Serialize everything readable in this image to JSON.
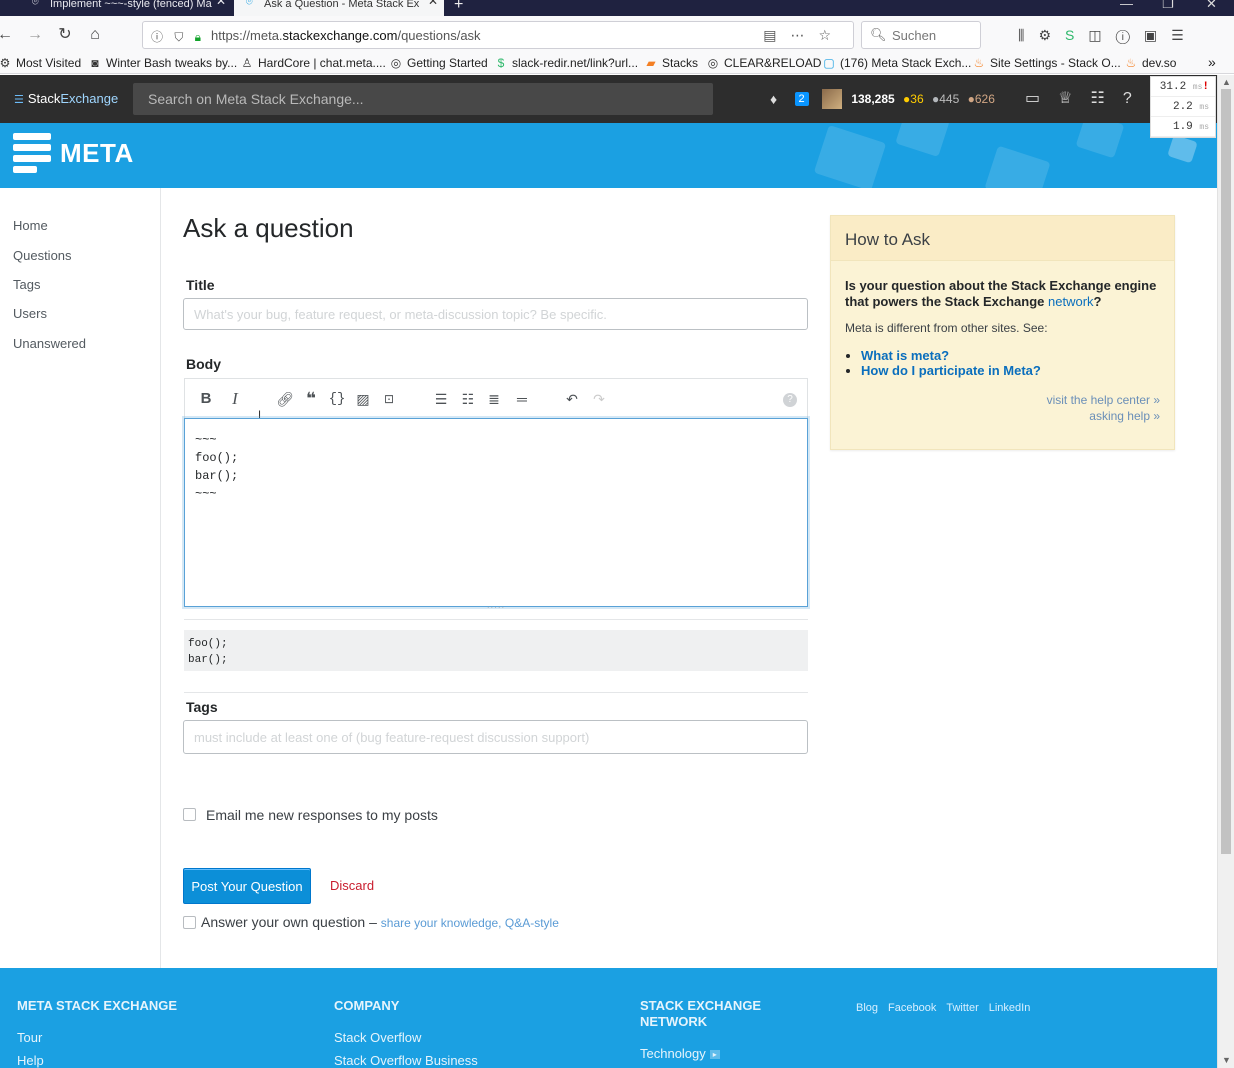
{
  "browser": {
    "tabs": [
      {
        "label": "Implement ~~~-style (fenced) Ma"
      },
      {
        "label": "Ask a Question - Meta Stack Ex"
      }
    ],
    "url_prefix": "https://meta.",
    "url_domain": "stackexchange.com",
    "url_path": "/questions/ask",
    "search_placeholder": "Suchen",
    "bookmarks": [
      "Most Visited",
      "Winter Bash tweaks by...",
      "HardCore | chat.meta....",
      "Getting Started",
      "slack-redir.net/link?url...",
      "Stacks",
      "CLEAR&RELOAD",
      "(176) Meta Stack Exch...",
      "Site Settings - Stack O...",
      "dev.so"
    ]
  },
  "se_topbar": {
    "logo_stack": "Stack",
    "logo_exchange": "Exchange",
    "search_placeholder": "Search on Meta Stack Exchange...",
    "inbox_count": "2",
    "reputation": "138,285",
    "gold": "36",
    "silver": "445",
    "bronze": "626"
  },
  "perf": {
    "t1": "31.2",
    "t1_unit": "ms",
    "t1_flag": "!",
    "t2": "2.2",
    "t2_unit": "ms",
    "t3": "1.9",
    "t3_unit": "ms"
  },
  "site": {
    "name": "META"
  },
  "leftnav": {
    "items": [
      "Home",
      "Questions",
      "Tags",
      "Users",
      "Unanswered"
    ]
  },
  "form": {
    "page_title": "Ask a question",
    "title_label": "Title",
    "title_placeholder": "What's your bug, feature request, or meta-discussion topic? Be specific.",
    "body_label": "Body",
    "body_text": "~~~\nfoo();\nbar();\n~~~",
    "preview_text": "foo();\nbar();",
    "tags_label": "Tags",
    "tags_placeholder": "must include at least one of (bug feature-request discussion support)",
    "email_label": "Email me new responses to my posts",
    "post_button": "Post Your Question",
    "discard": "Discard",
    "answer_own": "Answer your own question",
    "answer_dash": " – ",
    "answer_share": "share your knowledge, Q&A-style"
  },
  "toolbar_icons": [
    "bold-icon",
    "italic-icon",
    "link-icon",
    "quote-icon",
    "code-icon",
    "image-icon",
    "snippet-icon",
    "ordered-list-icon",
    "bullet-list-icon",
    "heading-icon",
    "horizontal-rule-icon",
    "undo-icon",
    "redo-icon",
    "help-icon"
  ],
  "howto": {
    "title": "How to Ask",
    "question_pre": "Is your question about the Stack Exchange engine that powers the Stack Exchange ",
    "question_link": "network",
    "question_post": "?",
    "para": "Meta is different from other sites. See:",
    "links": [
      "What is meta?",
      "How do I participate in Meta?"
    ],
    "help_center": "visit the help center »",
    "asking_help": "asking help »"
  },
  "footer": {
    "col1_head": "META STACK EXCHANGE",
    "col1_links": [
      "Tour",
      "Help"
    ],
    "col2_head": "COMPANY",
    "col2_links": [
      "Stack Overflow",
      "Stack Overflow Business"
    ],
    "col3_head": "STACK EXCHANGE NETWORK",
    "col3_links": [
      "Technology"
    ],
    "social": [
      "Blog",
      "Facebook",
      "Twitter",
      "LinkedIn"
    ]
  },
  "colors": {
    "meta_blue": "#1ba0e2",
    "button_blue": "#0c8fd8",
    "discard_red": "#c91d2e",
    "howto_bg": "#fbf3d5"
  }
}
